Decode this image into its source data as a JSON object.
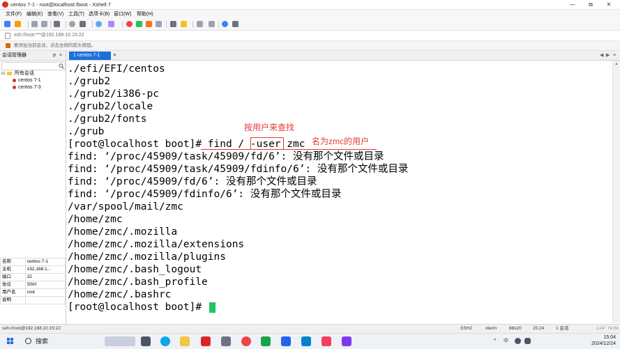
{
  "window": {
    "title": "centos 7-1 - root@localhost:/boot - Xshell 7",
    "icons": {
      "minimize": "minimize-icon",
      "maximize": "maximize-icon",
      "close": "close-icon"
    }
  },
  "menu": {
    "items": [
      "文件(F)",
      "编辑(E)",
      "查看(V)",
      "工具(T)",
      "选项卡(B)",
      "窗口(W)",
      "帮助(H)"
    ]
  },
  "address": {
    "value": "ssh://root:***@192.168.10.15:22"
  },
  "tip": {
    "text": "要添加当前会话，点击左侧的箭头按钮。"
  },
  "session_manager": {
    "title": "会话管理器",
    "pin": "ᵽ",
    "close": "×",
    "tree": {
      "root": "所有会话",
      "items": [
        "centos 7-1",
        "centos 7-3"
      ]
    },
    "properties": [
      {
        "key": "名称",
        "value": "centos 7-1"
      },
      {
        "key": "主机",
        "value": "192.168.1..."
      },
      {
        "key": "端口",
        "value": "22"
      },
      {
        "key": "协议",
        "value": "SSH"
      },
      {
        "key": "用户名",
        "value": "root"
      },
      {
        "key": "说明",
        "value": ""
      }
    ]
  },
  "tabs": {
    "active_label": "1 centos 7-1",
    "add": "+",
    "nav_left": "◀",
    "nav_right": "▶",
    "menu": "≡"
  },
  "terminal": {
    "lines": [
      "./efi/EFI/centos",
      "./grub2",
      "./grub2/i386-pc",
      "./grub2/locale",
      "./grub2/fonts",
      "./grub",
      "[root@localhost boot]# find / -user zmc",
      "find: ‘/proc/45909/task/45909/fd/6’: 没有那个文件或目录",
      "find: ‘/proc/45909/task/45909/fdinfo/6’: 没有那个文件或目录",
      "find: ‘/proc/45909/fd/6’: 没有那个文件或目录",
      "find: ‘/proc/45909/fdinfo/6’: 没有那个文件或目录",
      "/var/spool/mail/zmc",
      "/home/zmc",
      "/home/zmc/.mozilla",
      "/home/zmc/.mozilla/extensions",
      "/home/zmc/.mozilla/plugins",
      "/home/zmc/.bash_logout",
      "/home/zmc/.bash_profile",
      "/home/zmc/.bashrc",
      "[root@localhost boot]# "
    ],
    "annotations": {
      "by_user": "按用户来查找",
      "named_zmc": "名为zmc的用户"
    },
    "cursor_color": "#22c55e"
  },
  "status": {
    "connection": "ssh://root@192.168.10.15:22",
    "protocol": "SSH2",
    "term": "xterm",
    "size": "88x20",
    "position": "20,24",
    "sessions": "1 会话",
    "cap": "CAP",
    "num": "NUM"
  },
  "taskbar": {
    "search_label": "搜索",
    "tray_caret": "^",
    "tray_lang": "中",
    "time": "15:04",
    "date": "2024/12/24"
  },
  "colors": {
    "accent": "#1e6fd9",
    "annotation": "#e53935",
    "app_icon": "#d93025"
  }
}
